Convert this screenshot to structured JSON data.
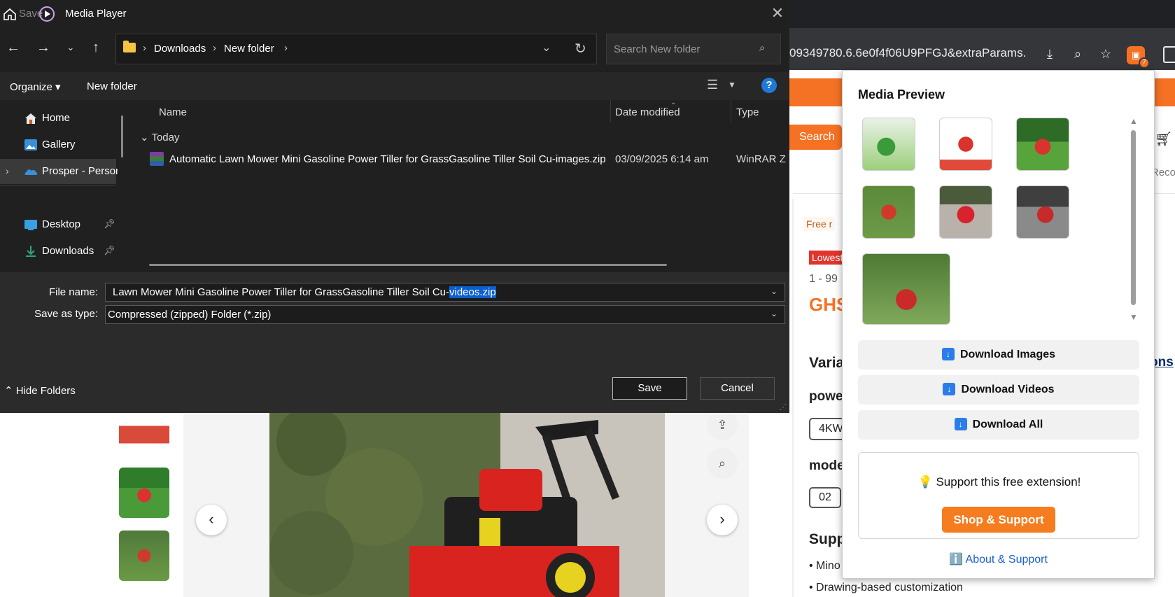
{
  "browser": {
    "url_fragment": "09349780.6.6e0f4f06U9PFGJ&extraParams...",
    "ext_badge": "7"
  },
  "page": {
    "search_label": "Search",
    "recom": "Recor",
    "free": "Free r",
    "lowest": "Lowest",
    "range": "1 - 99",
    "price": "GHS",
    "variations": "Varia",
    "ons": "ons",
    "power": "powe",
    "power_option": "4KW",
    "model": "mode",
    "model_option": "02",
    "support": "Supp",
    "bullet1": "• Mino",
    "bullet2": "• Drawing-based customization"
  },
  "dialog": {
    "app_save_label": "Save",
    "title": "Media Player",
    "breadcrumbs": [
      "Downloads",
      "New folder"
    ],
    "search_placeholder": "Search New folder",
    "organize": "Organize",
    "new_folder": "New folder",
    "help": "?",
    "nav_items": [
      {
        "label": "Home",
        "icon": "home-icon"
      },
      {
        "label": "Gallery",
        "icon": "gallery-icon"
      },
      {
        "label": "Prosper - Person",
        "icon": "onedrive-icon"
      },
      {
        "label": "Desktop",
        "icon": "desktop-icon"
      },
      {
        "label": "Downloads",
        "icon": "downloads-icon"
      }
    ],
    "columns": {
      "name": "Name",
      "date": "Date modified",
      "type": "Type"
    },
    "group": "Today",
    "file": {
      "name": "Automatic Lawn Mower Mini Gasoline Power Tiller for GrassGasoline Tiller Soil Cu-images.zip",
      "date": "03/09/2025 6:14 am",
      "type": "WinRAR Z"
    },
    "file_name_label": "File name:",
    "file_name_value_start": "Lawn Mower Mini Gasoline Power Tiller for GrassGasoline Tiller Soil Cu-",
    "file_name_value_selected": "videos.zip",
    "save_type_label": "Save as type:",
    "save_type_value": "Compressed (zipped) Folder (*.zip)",
    "hide_folders": "Hide Folders",
    "save": "Save",
    "cancel": "Cancel"
  },
  "popup": {
    "title": "Media Preview",
    "buttons": {
      "images": "Download Images",
      "videos": "Download Videos",
      "all": "Download All"
    },
    "support_text": "💡 Support this free extension!",
    "shop": "Shop & Support",
    "about": "ℹ️ About & Support"
  },
  "colors": {
    "accent_orange": "#f57224",
    "dialog_bg": "#202020",
    "selection_blue": "#0b5fcf",
    "link_blue": "#1a5fcc"
  }
}
